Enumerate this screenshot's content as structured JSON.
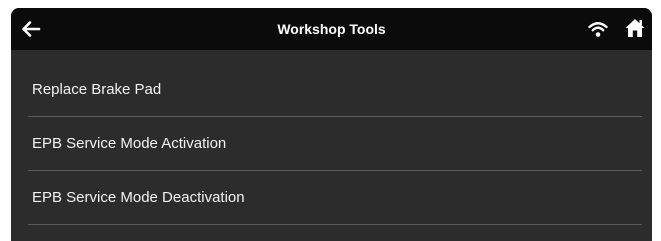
{
  "header": {
    "title": "Workshop Tools",
    "back_icon": "arrow-left-icon",
    "wifi_icon": "wifi-icon",
    "home_icon": "home-icon"
  },
  "menu": {
    "items": [
      {
        "label": "Replace Brake Pad"
      },
      {
        "label": "EPB Service Mode Activation"
      },
      {
        "label": "EPB Service Mode Deactivation"
      }
    ]
  },
  "colors": {
    "header_bg": "#0b0b0b",
    "body_bg": "#2c2c2c",
    "text": "#f2f2f2",
    "divider": "#5a5a5a"
  }
}
